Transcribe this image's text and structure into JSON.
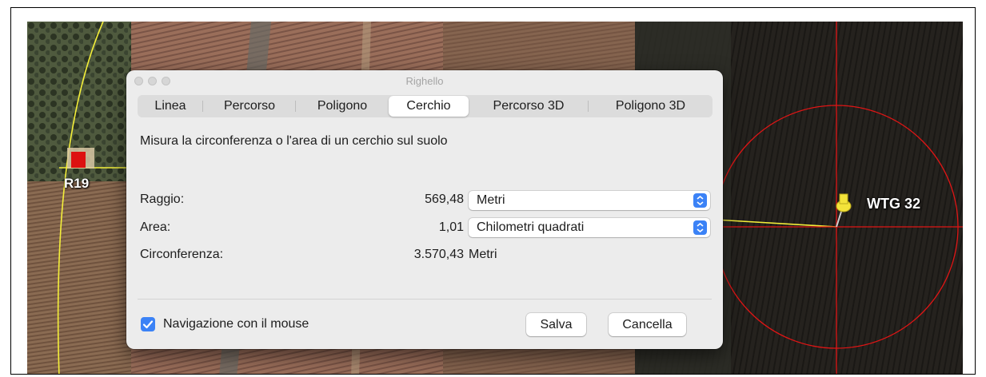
{
  "map": {
    "markers": [
      {
        "label": "R19"
      },
      {
        "label": "WTG 32"
      }
    ]
  },
  "dialog": {
    "title": "Righello",
    "tabs": [
      {
        "label": "Linea",
        "active": false
      },
      {
        "label": "Percorso",
        "active": false
      },
      {
        "label": "Poligono",
        "active": false
      },
      {
        "label": "Cerchio",
        "active": true
      },
      {
        "label": "Percorso 3D",
        "active": false
      },
      {
        "label": "Poligono 3D",
        "active": false
      }
    ],
    "description": "Misura la circonferenza o l'area di un cerchio sul suolo",
    "rows": [
      {
        "label": "Raggio:",
        "value": "569,48",
        "unit": "Metri"
      },
      {
        "label": "Area:",
        "value": "1,01",
        "unit": "Chilometri quadrati"
      },
      {
        "label": "Circonferenza:",
        "value": "3.570,43",
        "unit": "Metri"
      }
    ],
    "checkbox": {
      "label": "Navigazione con il mouse",
      "checked": true
    },
    "buttons": {
      "save": "Salva",
      "cancel": "Cancella"
    }
  },
  "colors": {
    "accent": "#3b82f6",
    "circle": "#e01515",
    "line": "#f4ef3a"
  }
}
